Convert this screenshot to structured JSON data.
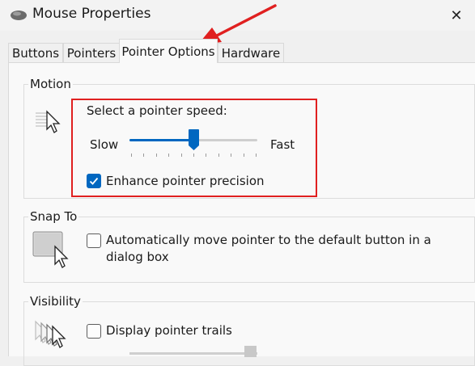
{
  "window": {
    "title": "Mouse Properties",
    "close_glyph": "✕"
  },
  "tabs": [
    {
      "label": "Buttons",
      "active": false
    },
    {
      "label": "Pointers",
      "active": false
    },
    {
      "label": "Pointer Options",
      "active": true
    },
    {
      "label": "Hardware",
      "active": false
    }
  ],
  "motion": {
    "group_label": "Motion",
    "speed_label": "Select a pointer speed:",
    "slow_label": "Slow",
    "fast_label": "Fast",
    "speed_value_fraction": 0.5,
    "enhance_label": "Enhance pointer precision",
    "enhance_checked": true
  },
  "snap_to": {
    "group_label": "Snap To",
    "option_label_line1": "Automatically move pointer to the default button in a",
    "option_label_line2": "dialog box",
    "checked": false
  },
  "visibility": {
    "group_label": "Visibility",
    "trails_label": "Display pointer trails",
    "trails_checked": false
  },
  "colors": {
    "accent": "#0067c0",
    "annotation_red": "#e02020"
  },
  "icons": [
    "mouse-device-icon",
    "close-icon",
    "pointer-speed-icon",
    "snap-to-icon",
    "pointer-trails-icon",
    "checkmark-icon",
    "annotation-arrow"
  ]
}
